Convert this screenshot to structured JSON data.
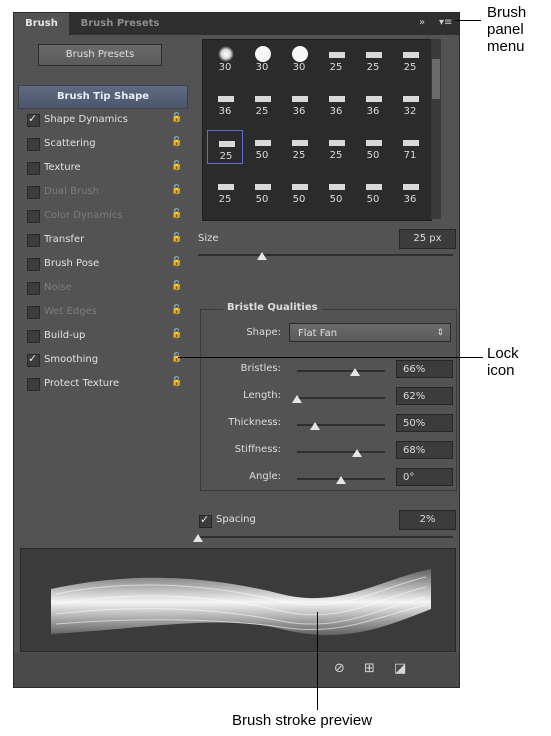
{
  "tabs": {
    "active": "Brush",
    "inactive": "Brush Presets"
  },
  "toolbar_icons": {
    "collapse": "»",
    "menu": "▾≡"
  },
  "left_panel": {
    "presets_button": "Brush Presets",
    "options": [
      {
        "label": "Brush Tip Shape",
        "type": "header"
      },
      {
        "label": "Shape Dynamics",
        "checked": true,
        "dim": false
      },
      {
        "label": "Scattering",
        "checked": false,
        "dim": false
      },
      {
        "label": "Texture",
        "checked": false,
        "dim": false
      },
      {
        "label": "Dual Brush",
        "checked": false,
        "dim": true
      },
      {
        "label": "Color Dynamics",
        "checked": false,
        "dim": true
      },
      {
        "label": "Transfer",
        "checked": false,
        "dim": false
      },
      {
        "label": "Brush Pose",
        "checked": false,
        "dim": false
      },
      {
        "label": "Noise",
        "checked": false,
        "dim": true
      },
      {
        "label": "Wet Edges",
        "checked": false,
        "dim": true
      },
      {
        "label": "Build-up",
        "checked": false,
        "dim": false
      },
      {
        "label": "Smoothing",
        "checked": true,
        "dim": false
      },
      {
        "label": "Protect Texture",
        "checked": false,
        "dim": false
      }
    ]
  },
  "brush_grid": {
    "rows": [
      [
        "30",
        "30",
        "30",
        "25",
        "25",
        "25"
      ],
      [
        "36",
        "25",
        "36",
        "36",
        "36",
        "32"
      ],
      [
        "25",
        "50",
        "25",
        "25",
        "50",
        "71"
      ],
      [
        "25",
        "50",
        "50",
        "50",
        "50",
        "36"
      ]
    ],
    "selected": {
      "row": 2,
      "col": 0
    }
  },
  "size": {
    "label": "Size",
    "value": "25 px",
    "slider_fraction": 0.25
  },
  "bristle": {
    "title": "Bristle Qualities",
    "shape_label": "Shape:",
    "shape_value": "Flat Fan",
    "rows": [
      {
        "label": "Bristles:",
        "value": "66%",
        "fraction": 0.66
      },
      {
        "label": "Length:",
        "value": "62%",
        "fraction": 0.0
      },
      {
        "label": "Thickness:",
        "value": "50%",
        "fraction": 0.2
      },
      {
        "label": "Stiffness:",
        "value": "68%",
        "fraction": 0.68
      },
      {
        "label": "Angle:",
        "value": "0°",
        "fraction": 0.5
      }
    ]
  },
  "spacing": {
    "label": "Spacing",
    "checked": true,
    "value": "2%",
    "slider_fraction": 0.0
  },
  "bottom_icons": [
    "brush-toggle-icon",
    "grid-icon",
    "new-preset-icon"
  ],
  "callouts": {
    "panel_menu": "Brush\npanel\nmenu",
    "lock_icon": "Lock\nicon",
    "stroke_preview": "Brush stroke preview"
  }
}
